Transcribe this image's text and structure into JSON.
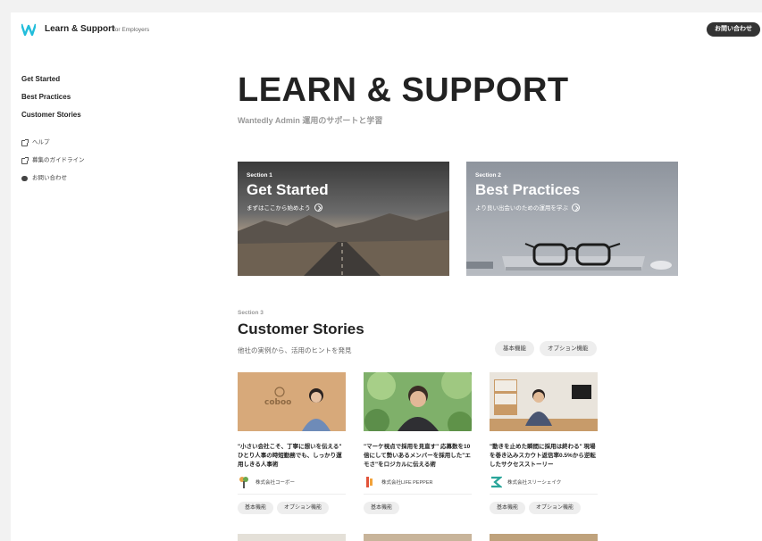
{
  "header": {
    "brand": "Learn & Support",
    "brand_sub": "for Employers",
    "contact_button": "お問い合わせ",
    "colors": {
      "logo": "#21bddb",
      "button": "#333333"
    }
  },
  "sidebar": {
    "main_items": [
      "Get Started",
      "Best Practices",
      "Customer Stories"
    ],
    "sub_items": [
      {
        "label": "ヘルプ",
        "icon": "external-link-icon"
      },
      {
        "label": "募集のガイドライン",
        "icon": "external-link-icon"
      },
      {
        "label": "お問い合わせ",
        "icon": "chat-icon"
      }
    ]
  },
  "hero": {
    "title": "LEARN & SUPPORT",
    "subtitle": "Wantedly Admin 運用のサポートと学習"
  },
  "sections": [
    {
      "label": "Section 1",
      "title": "Get Started",
      "sub": "まずはここから始めよう"
    },
    {
      "label": "Section 2",
      "title": "Best Practices",
      "sub": "より良い出会いのための運用を学ぶ"
    }
  ],
  "section3": {
    "label": "Section 3",
    "title": "Customer Stories",
    "sub": "他社の実例から、活用のヒントを発見",
    "filters": [
      "基本機能",
      "オプション機能"
    ]
  },
  "stories": [
    {
      "text": "\"小さい会社こそ、丁寧に想いを伝える\" ひとり人事の時短勤務でも、しっかり運用しきる人事術",
      "company": "株式会社コーボー",
      "tags": [
        "基本機能",
        "オプション機能"
      ]
    },
    {
      "text": "\"マーケ視点で採用を見直す\" 応募数を10倍にして勢いあるメンバーを採用した\"エモさ\"をロジカルに伝える術",
      "company": "株式会社LIFE PEPPER",
      "tags": [
        "基本機能"
      ]
    },
    {
      "text": "\"動きを止めた瞬間に採用は終わる\" 現場を巻き込みスカウト返信率0.5%から逆転したサクセスストーリー",
      "company": "株式会社スリーシェイク",
      "tags": [
        "基本機能",
        "オプション機能"
      ]
    }
  ]
}
